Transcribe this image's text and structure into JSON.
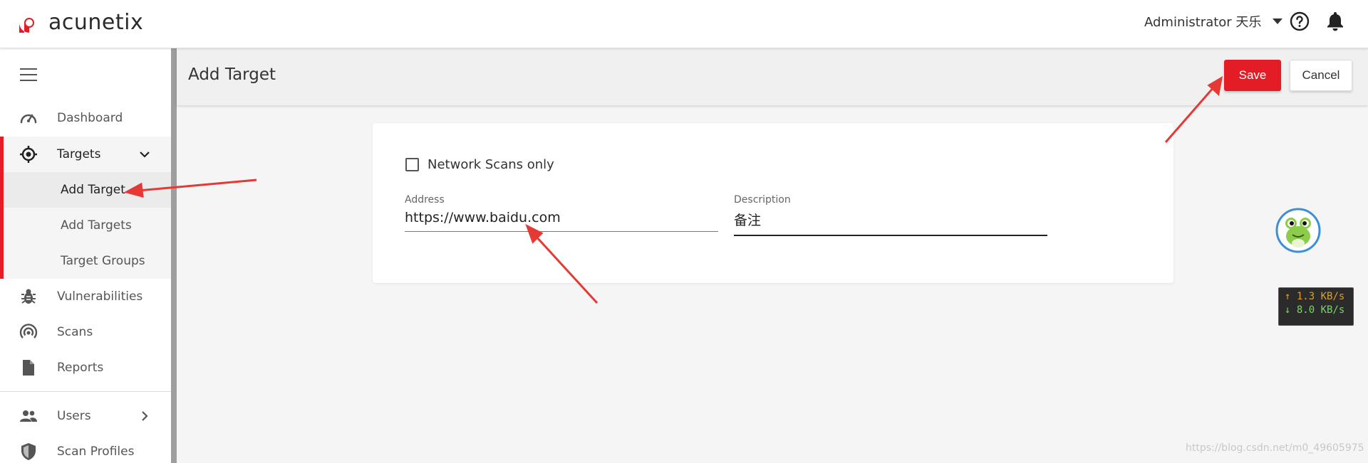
{
  "app": {
    "brand": "acunetix",
    "accent": "#e31c25"
  },
  "header": {
    "user": "Administrator 天乐"
  },
  "sidebar": {
    "items": [
      {
        "label": "Dashboard",
        "icon": "dashboard-gauge-icon"
      },
      {
        "label": "Targets",
        "icon": "target-crosshair-icon"
      },
      {
        "label": "Vulnerabilities",
        "icon": "bug-icon"
      },
      {
        "label": "Scans",
        "icon": "radar-icon"
      },
      {
        "label": "Reports",
        "icon": "document-icon"
      },
      {
        "label": "Users",
        "icon": "users-icon"
      },
      {
        "label": "Scan Profiles",
        "icon": "shield-icon"
      }
    ],
    "target_subitems": [
      "Add Target",
      "Add Targets",
      "Target Groups"
    ]
  },
  "page": {
    "title": "Add Target",
    "save_label": "Save",
    "cancel_label": "Cancel"
  },
  "form": {
    "network_scans_label": "Network Scans only",
    "address_label": "Address",
    "address_value": "https://www.baidu.com",
    "description_label": "Description",
    "description_value": "备注"
  },
  "netspeed": {
    "up": "↑ 1.3 KB/s",
    "down": "↓ 8.0 KB/s"
  },
  "watermark": "https://blog.csdn.net/m0_49605975"
}
